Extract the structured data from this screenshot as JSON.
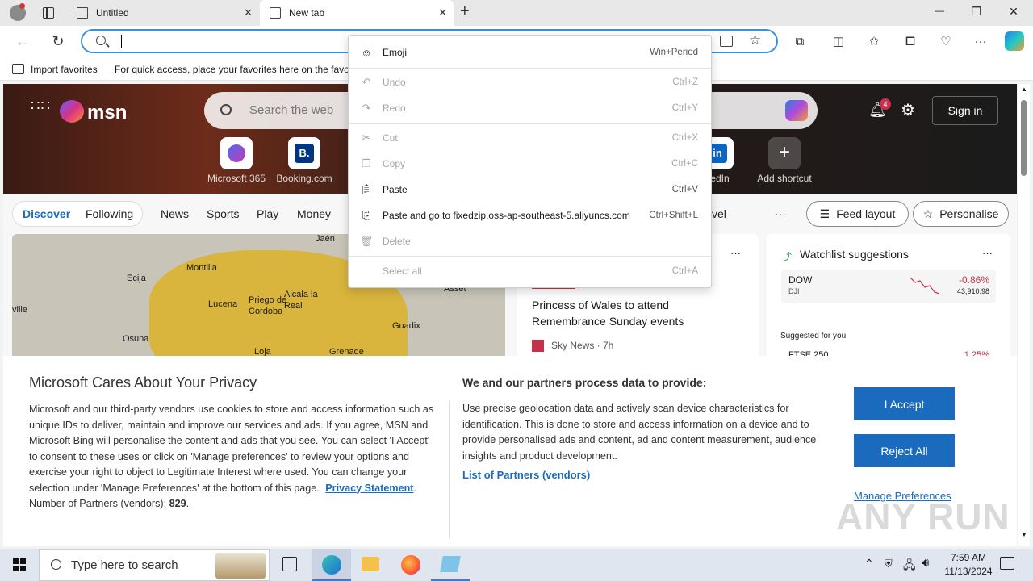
{
  "tabs": [
    {
      "title": "Untitled",
      "close": "✕"
    },
    {
      "title": "New tab",
      "close": "✕"
    }
  ],
  "new_tab": "+",
  "window_controls": {
    "minimize": "—",
    "restore": "❐",
    "close": "✕"
  },
  "address_bar": {
    "value": "",
    "placeholder": ""
  },
  "favorites_bar": {
    "import_label": "Import favorites",
    "hint": "For quick access, place your favorites here on the favor"
  },
  "msn": {
    "logo_text": "msn",
    "search_placeholder": "Search the web",
    "notification_count": "4",
    "sign_in": "Sign in",
    "shortcuts": [
      {
        "label": "Microsoft 365"
      },
      {
        "label": "Booking.com"
      },
      {
        "label": "kedIn"
      },
      {
        "label": "Add shortcut"
      }
    ],
    "nav": {
      "discover": "Discover",
      "following": "Following",
      "items": [
        "News",
        "Sports",
        "Play",
        "Money"
      ],
      "travel": "vel",
      "more": "···",
      "feed_layout": "Feed layout",
      "personalise": "Personalise"
    },
    "map_labels": [
      "Ecija",
      "Montilla",
      "Lucena",
      "Priego de Cordoba",
      "Alcala la Real",
      "Jaén",
      "Asset",
      "ville",
      "Osuna",
      "Loja",
      "Guadix",
      "Grenade"
    ],
    "news": {
      "title": "Princess of Wales to attend Remembrance Sunday events",
      "source": "Sky News · 7h",
      "more": "···"
    },
    "watchlist": {
      "title": "Watchlist suggestions",
      "more": "···",
      "symbol": "DOW",
      "sub": "DJI",
      "change": "-0.86%",
      "value": "43,910.98",
      "suggested": "Suggested for you",
      "ftse": "FTSE 250",
      "ftse_change": "1.25%"
    }
  },
  "context_menu": {
    "items": [
      {
        "label": "Emoji",
        "shortcut": "Win+Period",
        "icon": "emoji-icon",
        "disabled": false
      },
      {
        "label": "Undo",
        "shortcut": "Ctrl+Z",
        "icon": "undo-icon",
        "disabled": true
      },
      {
        "label": "Redo",
        "shortcut": "Ctrl+Y",
        "icon": "redo-icon",
        "disabled": true
      },
      {
        "label": "Cut",
        "shortcut": "Ctrl+X",
        "icon": "cut-icon",
        "disabled": true
      },
      {
        "label": "Copy",
        "shortcut": "Ctrl+C",
        "icon": "copy-icon",
        "disabled": true
      },
      {
        "label": "Paste",
        "shortcut": "Ctrl+V",
        "icon": "paste-icon",
        "disabled": false
      },
      {
        "label": "Paste and go to fixedzip.oss-ap-southeast-5.aliyuncs.com",
        "shortcut": "Ctrl+Shift+L",
        "icon": "paste-go-icon",
        "disabled": false
      },
      {
        "label": "Delete",
        "shortcut": "",
        "icon": "delete-icon",
        "disabled": true
      },
      {
        "label": "Select all",
        "shortcut": "Ctrl+A",
        "icon": "",
        "disabled": true
      }
    ]
  },
  "privacy": {
    "title": "Microsoft Cares About Your Privacy",
    "body": "Microsoft and our third-party vendors use cookies to store and access information such as unique IDs to deliver, maintain and improve our services and ads. If you agree, MSN and Microsoft Bing will personalise the content and ads that you see. You can select 'I Accept' to consent to these uses or click on 'Manage preferences' to review your options and exercise your right to object to Legitimate Interest where used.  You can change your selection under 'Manage Preferences' at the bottom of this page.",
    "privacy_link": "Privacy Statement",
    "partners_prefix": "Number of Partners (vendors): ",
    "partners_count": "829",
    "partners_suffix": ".",
    "right_title": "We and our partners process data to provide:",
    "right_body": "Use precise geolocation data and actively scan device characteristics for identification. This is done to store and access information on a device and to provide personalised ads and content, ad and content measurement, audience insights and product development.",
    "partners_link": "List of Partners (vendors)",
    "accept": "I Accept",
    "reject": "Reject All",
    "manage": "Manage Preferences"
  },
  "watermark": "ANY RUN",
  "taskbar": {
    "search_placeholder": "Type here to search",
    "time": "7:59 AM",
    "date": "11/13/2024"
  }
}
